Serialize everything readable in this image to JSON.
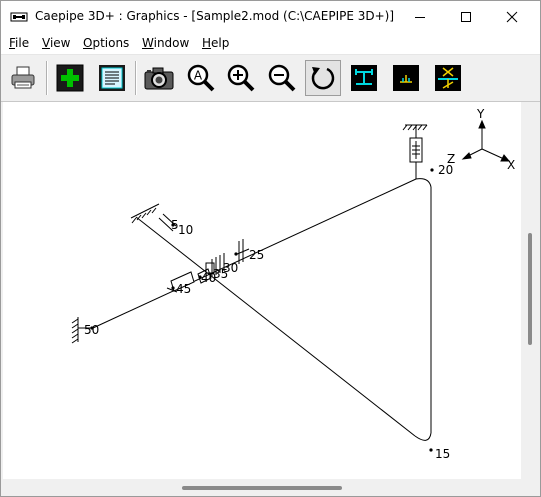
{
  "window": {
    "title": "Caepipe 3D+ : Graphics -  [Sample2.mod (C:\\CAEPIPE 3D+)]"
  },
  "menu": [
    {
      "accel": "F",
      "rest": "ile"
    },
    {
      "accel": "V",
      "rest": "iew"
    },
    {
      "accel": "O",
      "rest": "ptions"
    },
    {
      "accel": "W",
      "rest": "indow"
    },
    {
      "accel": "H",
      "rest": "elp"
    }
  ],
  "toolbar": {
    "items": [
      "print-icon",
      "add-icon",
      "list-icon",
      "camera-icon",
      "zoom-all-icon",
      "zoom-in-icon",
      "zoom-out-icon",
      "rotate-icon",
      "show-supports-icon",
      "show-nodes-icon",
      "show-anchors-icon"
    ],
    "zoom_all_letter": "A",
    "pressed": "rotate-icon"
  },
  "model": {
    "nodes": [
      {
        "id": "5",
        "label": "5"
      },
      {
        "id": "10",
        "label": "10"
      },
      {
        "id": "15",
        "label": "15"
      },
      {
        "id": "20",
        "label": "20"
      },
      {
        "id": "25",
        "label": "25"
      },
      {
        "id": "30",
        "label": "30"
      },
      {
        "id": "35",
        "label": "35"
      },
      {
        "id": "40",
        "label": "40"
      },
      {
        "id": "45",
        "label": "45"
      },
      {
        "id": "50",
        "label": "50"
      }
    ],
    "axes": {
      "x": "X",
      "y": "Y",
      "z": "Z"
    }
  },
  "colors": {
    "pipe": "#000000",
    "accent_green": "#00a000",
    "toolbar_dark": "#1a1a1a",
    "cyan": "#00c8d0",
    "yellow": "#f0d000"
  }
}
